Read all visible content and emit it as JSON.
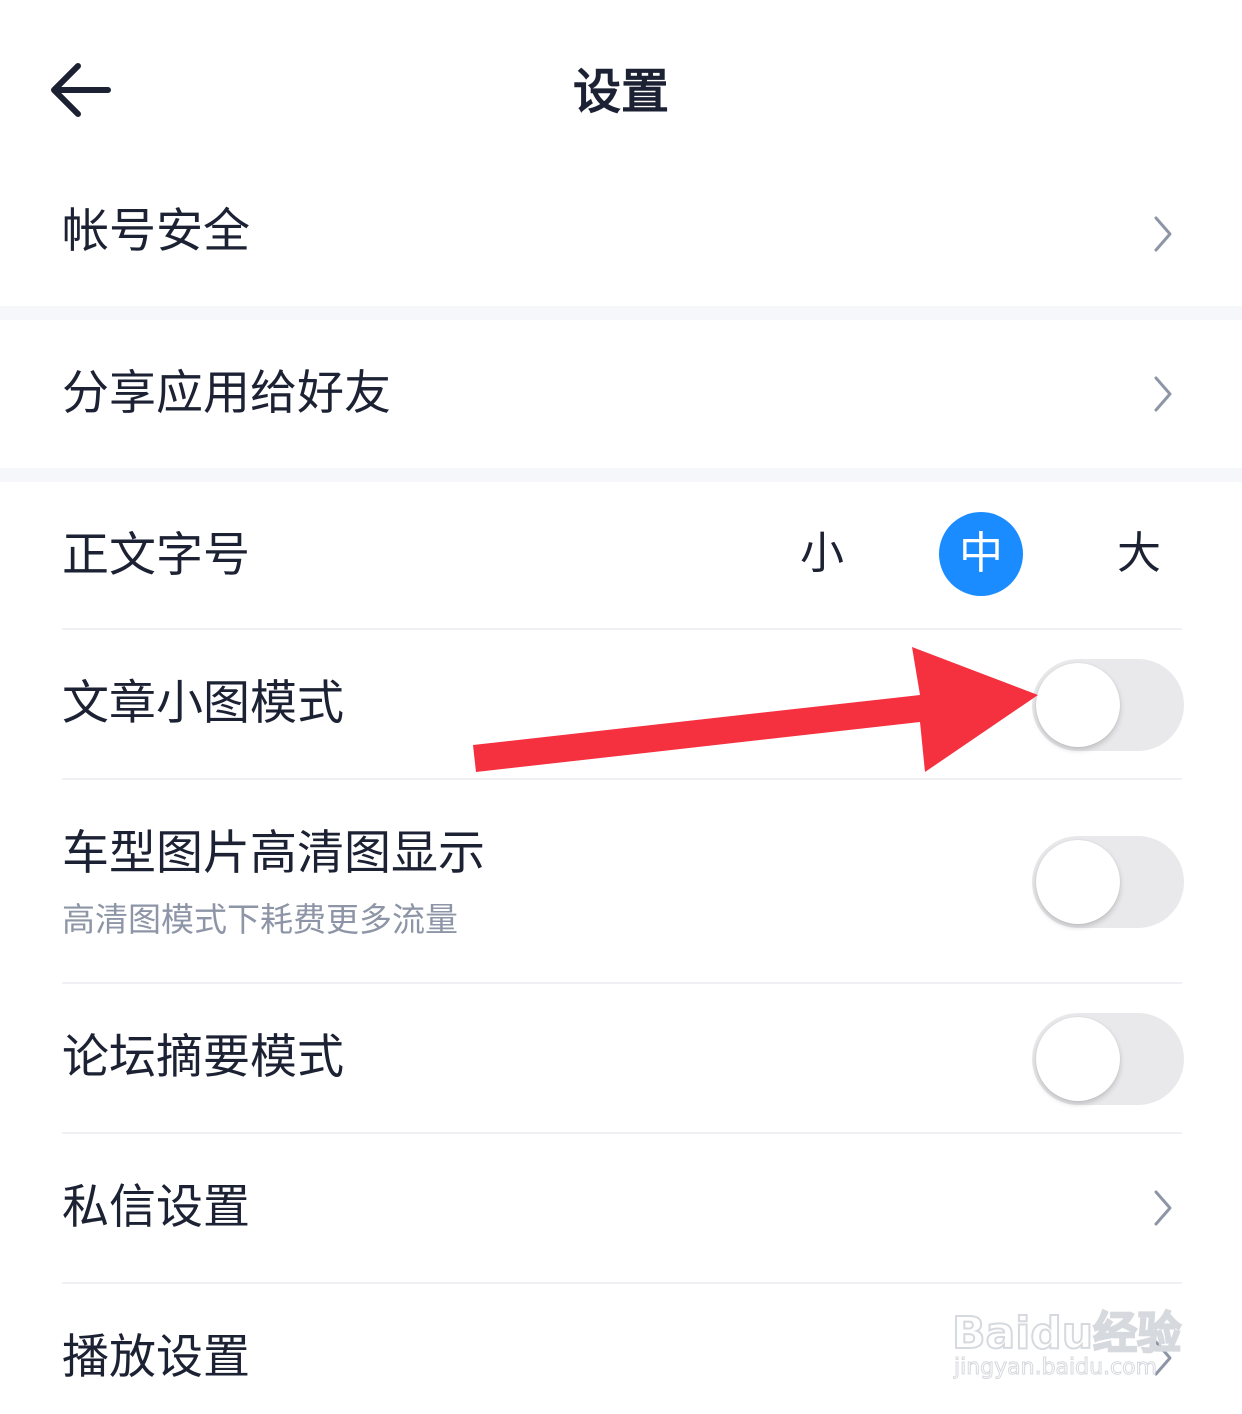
{
  "header": {
    "title": "设置",
    "back_icon": "arrow-left-icon"
  },
  "items": {
    "account_security": {
      "label": "帐号安全"
    },
    "share_app": {
      "label": "分享应用给好友"
    },
    "font_size": {
      "label": "正文字号",
      "options": [
        "小",
        "中",
        "大"
      ],
      "selected": "中"
    },
    "article_small_image": {
      "label": "文章小图模式",
      "enabled": false
    },
    "car_hd_image": {
      "label": "车型图片高清图显示",
      "sublabel": "高清图模式下耗费更多流量",
      "enabled": false
    },
    "forum_summary": {
      "label": "论坛摘要模式",
      "enabled": false
    },
    "private_message": {
      "label": "私信设置"
    },
    "playback": {
      "label": "播放设置"
    }
  },
  "annotation": {
    "type": "arrow",
    "color": "#f5303f",
    "points_to": "article_small_image toggle"
  },
  "watermark": {
    "brand": "Baidu经验",
    "url": "jingyan.baidu.com"
  },
  "colors": {
    "accent": "#1a8cff",
    "text": "#1c2233",
    "subtext": "#8d95a6",
    "toggle_off": "#e9e9ec",
    "section_gap": "#f5f7fa"
  }
}
